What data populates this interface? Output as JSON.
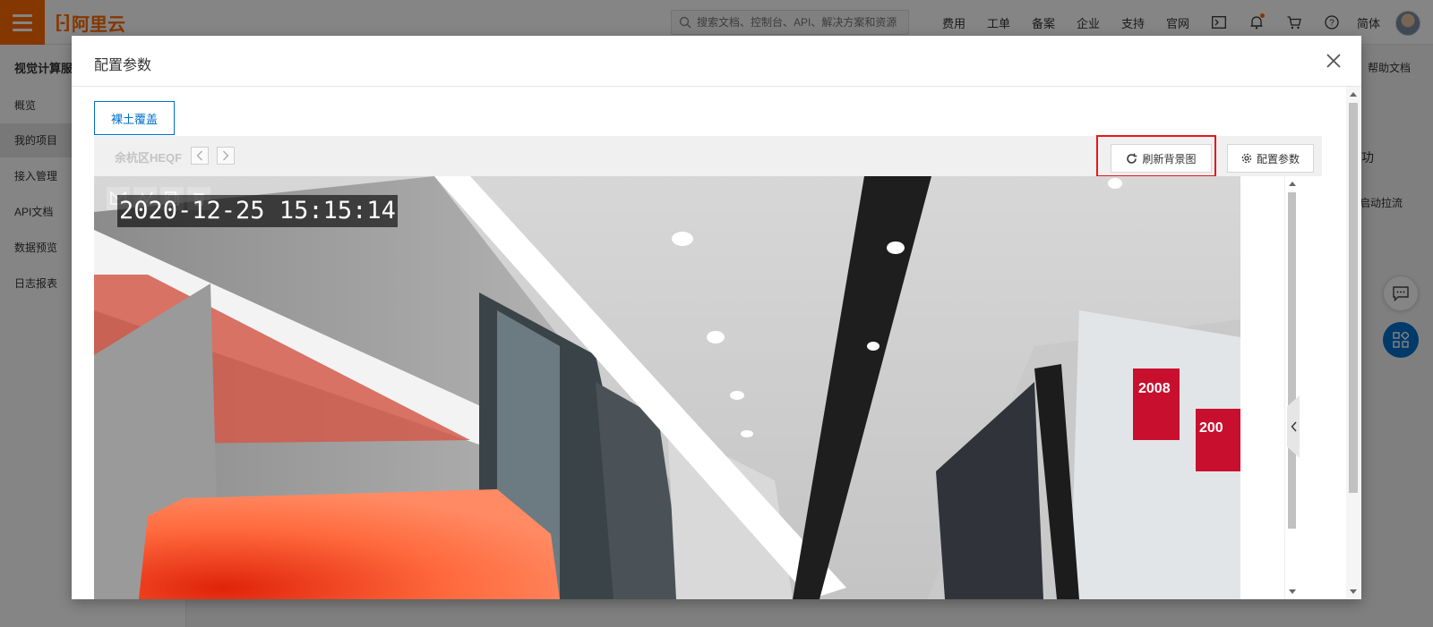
{
  "topbar": {
    "brand": "阿里云",
    "search_placeholder": "搜索文档、控制台、API、解决方案和资源",
    "nav": [
      "费用",
      "工单",
      "备案",
      "企业",
      "支持",
      "官网"
    ],
    "language": "简体",
    "icons": [
      "terminal-icon",
      "bell-icon",
      "cart-icon",
      "help-icon"
    ]
  },
  "sidebar": {
    "title": "视觉计算服",
    "items": [
      {
        "label": "概览"
      },
      {
        "label": "我的项目",
        "active": true
      },
      {
        "label": "接入管理"
      },
      {
        "label": "API文档"
      },
      {
        "label": "数据预览"
      },
      {
        "label": "日志报表"
      }
    ]
  },
  "background": {
    "help_link": "帮助文档",
    "partial_status": "功",
    "partial_text": "启动拉流"
  },
  "dialog": {
    "title": "配置参数",
    "scene_tab": "裸土覆盖",
    "camera_name": "余杭区HEQF",
    "refresh_button": "刷新背景图",
    "config_button": "配置参数",
    "timestamp": "2020-12-25 15:15:14",
    "drawing_tools": [
      "polygon-icon",
      "polyline-icon",
      "copy-icon",
      "delete-icon"
    ]
  },
  "colors": {
    "brand_orange": "#ff6a00",
    "primary_blue": "#0070cc",
    "highlight_red": "#e8161b"
  }
}
